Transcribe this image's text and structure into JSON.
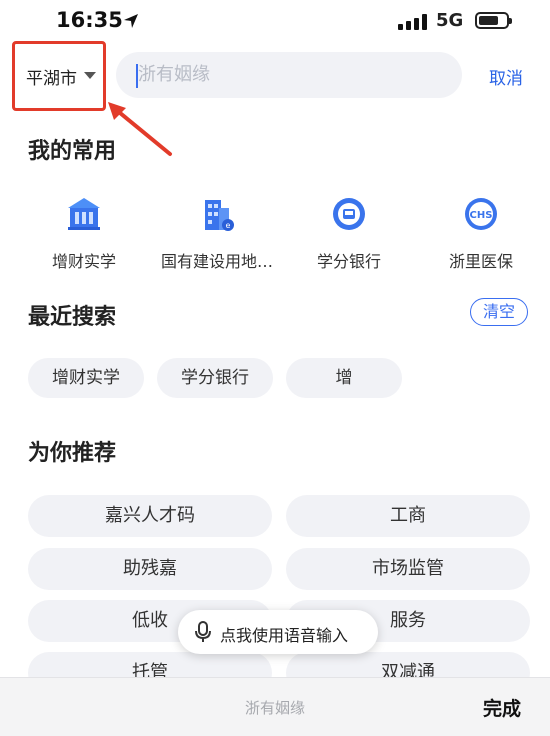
{
  "status": {
    "time": "16:35",
    "network": "5G"
  },
  "search": {
    "city": "平湖市",
    "placeholder": "浙有姻缘",
    "cancel_label": "取消"
  },
  "favorites": {
    "title": "我的常用",
    "items": [
      {
        "label": "增财实学",
        "icon": "bank-icon"
      },
      {
        "label": "国有建设用地…",
        "icon": "building-icon"
      },
      {
        "label": "学分银行",
        "icon": "credit-bank-icon"
      },
      {
        "label": "浙里医保",
        "icon": "medical-insurance-icon"
      }
    ]
  },
  "recent": {
    "title": "最近搜索",
    "clear_label": "清空",
    "items": [
      "增财实学",
      "学分银行",
      "增"
    ]
  },
  "recommend": {
    "title": "为你推荐",
    "items": [
      "嘉兴人才码",
      "工商",
      "助残嘉",
      "市场监管",
      "低收",
      "服务",
      "托管",
      "双减通"
    ]
  },
  "voice": {
    "label": "点我使用语音输入"
  },
  "toolbar": {
    "hint": "浙有姻缘",
    "done_label": "完成"
  },
  "colors": {
    "accent": "#2a63e6",
    "highlight": "#e23b2a",
    "chip_bg": "#f1f2f6"
  }
}
